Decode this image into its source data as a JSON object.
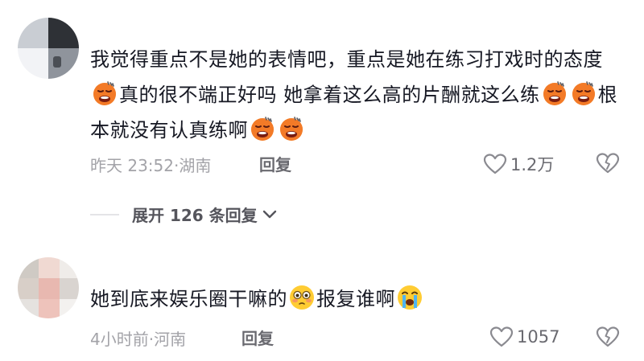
{
  "comments": [
    {
      "text_segments": [
        {
          "type": "text",
          "value": "我觉得重点不是她的表情吧，重点是她在练习打戏时的态度"
        },
        {
          "type": "emoji",
          "name": "pouting-face"
        },
        {
          "type": "text",
          "value": "真的很不端正好吗 她拿着这么高的片酬就这么练"
        },
        {
          "type": "emoji",
          "name": "pouting-face"
        },
        {
          "type": "emoji",
          "name": "pouting-face"
        },
        {
          "type": "text",
          "value": "根本就没有认真练啊"
        },
        {
          "type": "emoji",
          "name": "pouting-face"
        },
        {
          "type": "emoji",
          "name": "pouting-face"
        }
      ],
      "meta": "昨天 23:52·湖南",
      "reply_label": "回复",
      "like_count": "1.2万"
    },
    {
      "text_segments": [
        {
          "type": "text",
          "value": "她到底来娱乐圈干嘛的"
        },
        {
          "type": "emoji",
          "name": "flushed-face"
        },
        {
          "type": "text",
          "value": "报复谁啊"
        },
        {
          "type": "emoji",
          "name": "crying-face"
        }
      ],
      "meta": "4小时前·河南",
      "reply_label": "回复",
      "like_count": "1057"
    }
  ],
  "expand_replies": {
    "label": "展开 126 条回复"
  },
  "colors": {
    "text": "#161823",
    "meta": "#a3a3a8",
    "action": "#6a6a70"
  }
}
